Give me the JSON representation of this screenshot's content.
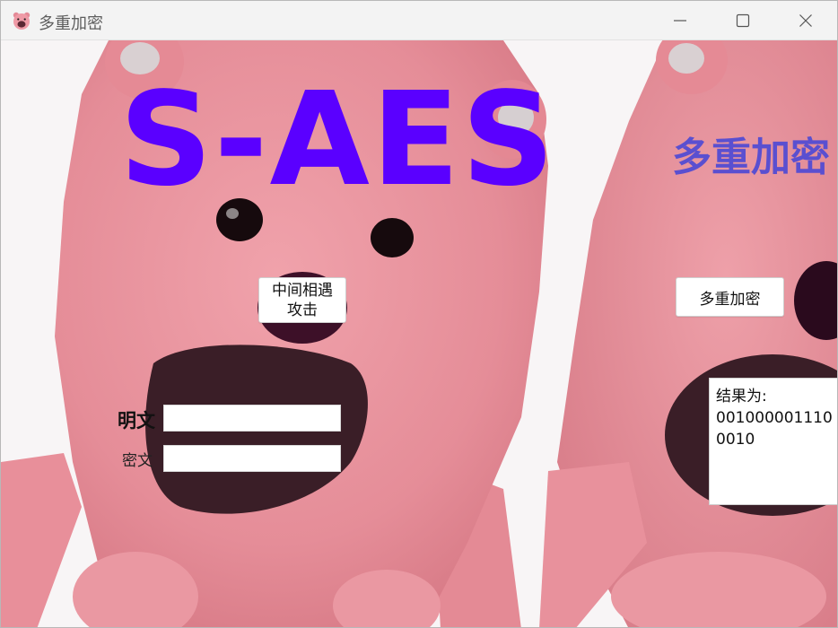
{
  "window": {
    "title": "多重加密",
    "icon": "pink-bear-icon",
    "controls": [
      "minimize-icon",
      "maximize-icon",
      "close-icon"
    ]
  },
  "header": {
    "main_title": "S-AES",
    "side_title": "多重加密"
  },
  "buttons": {
    "mitm_label": "中间相遇攻击",
    "multi_encrypt_label": "多重加密"
  },
  "form": {
    "plaintext_label": "明文",
    "plaintext_value": "",
    "ciphertext_label": "密文",
    "ciphertext_value": ""
  },
  "result": {
    "prefix": "结果为:",
    "value": "0010000011100010"
  },
  "colors": {
    "main_title": "#5a00ff",
    "side_title": "#5a4fd0",
    "bear_pink": "#e9919b",
    "mouth_dark": "#3a1e27"
  }
}
